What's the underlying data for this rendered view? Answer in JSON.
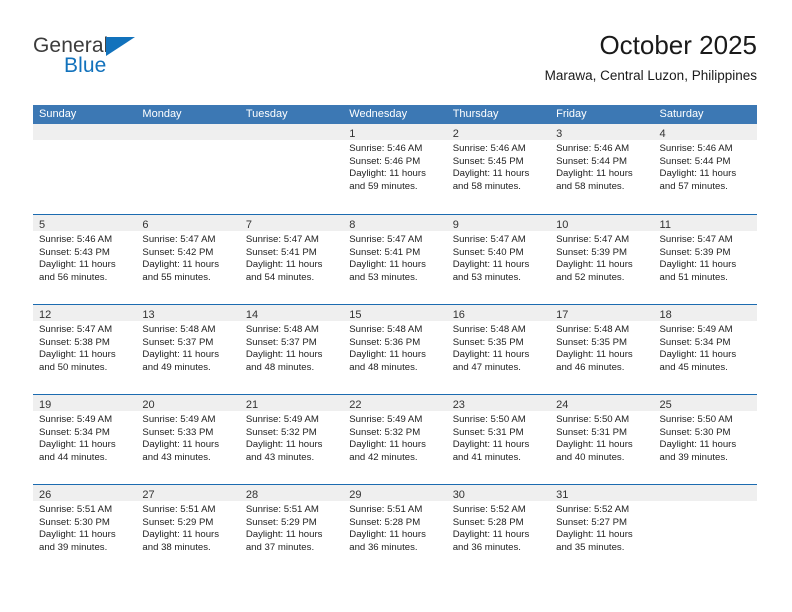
{
  "brand": {
    "name_part1": "General",
    "name_part2": "Blue"
  },
  "header": {
    "title": "October 2025",
    "subtitle": "Marawa, Central Luzon, Philippines"
  },
  "colors": {
    "header_blue": "#3c78b4",
    "week_divider_blue": "#1c6bb0",
    "daynum_strip": "#efefef",
    "brand_blue": "#1272bc"
  },
  "calendar": {
    "weekday_headers": [
      "Sunday",
      "Monday",
      "Tuesday",
      "Wednesday",
      "Thursday",
      "Friday",
      "Saturday"
    ],
    "weeks": [
      [
        {
          "day": "",
          "empty": true
        },
        {
          "day": "",
          "empty": true
        },
        {
          "day": "",
          "empty": true
        },
        {
          "day": "1",
          "sunrise": "Sunrise: 5:46 AM",
          "sunset": "Sunset: 5:46 PM",
          "daylight": "Daylight: 11 hours and 59 minutes."
        },
        {
          "day": "2",
          "sunrise": "Sunrise: 5:46 AM",
          "sunset": "Sunset: 5:45 PM",
          "daylight": "Daylight: 11 hours and 58 minutes."
        },
        {
          "day": "3",
          "sunrise": "Sunrise: 5:46 AM",
          "sunset": "Sunset: 5:44 PM",
          "daylight": "Daylight: 11 hours and 58 minutes."
        },
        {
          "day": "4",
          "sunrise": "Sunrise: 5:46 AM",
          "sunset": "Sunset: 5:44 PM",
          "daylight": "Daylight: 11 hours and 57 minutes."
        }
      ],
      [
        {
          "day": "5",
          "sunrise": "Sunrise: 5:46 AM",
          "sunset": "Sunset: 5:43 PM",
          "daylight": "Daylight: 11 hours and 56 minutes."
        },
        {
          "day": "6",
          "sunrise": "Sunrise: 5:47 AM",
          "sunset": "Sunset: 5:42 PM",
          "daylight": "Daylight: 11 hours and 55 minutes."
        },
        {
          "day": "7",
          "sunrise": "Sunrise: 5:47 AM",
          "sunset": "Sunset: 5:41 PM",
          "daylight": "Daylight: 11 hours and 54 minutes."
        },
        {
          "day": "8",
          "sunrise": "Sunrise: 5:47 AM",
          "sunset": "Sunset: 5:41 PM",
          "daylight": "Daylight: 11 hours and 53 minutes."
        },
        {
          "day": "9",
          "sunrise": "Sunrise: 5:47 AM",
          "sunset": "Sunset: 5:40 PM",
          "daylight": "Daylight: 11 hours and 53 minutes."
        },
        {
          "day": "10",
          "sunrise": "Sunrise: 5:47 AM",
          "sunset": "Sunset: 5:39 PM",
          "daylight": "Daylight: 11 hours and 52 minutes."
        },
        {
          "day": "11",
          "sunrise": "Sunrise: 5:47 AM",
          "sunset": "Sunset: 5:39 PM",
          "daylight": "Daylight: 11 hours and 51 minutes."
        }
      ],
      [
        {
          "day": "12",
          "sunrise": "Sunrise: 5:47 AM",
          "sunset": "Sunset: 5:38 PM",
          "daylight": "Daylight: 11 hours and 50 minutes."
        },
        {
          "day": "13",
          "sunrise": "Sunrise: 5:48 AM",
          "sunset": "Sunset: 5:37 PM",
          "daylight": "Daylight: 11 hours and 49 minutes."
        },
        {
          "day": "14",
          "sunrise": "Sunrise: 5:48 AM",
          "sunset": "Sunset: 5:37 PM",
          "daylight": "Daylight: 11 hours and 48 minutes."
        },
        {
          "day": "15",
          "sunrise": "Sunrise: 5:48 AM",
          "sunset": "Sunset: 5:36 PM",
          "daylight": "Daylight: 11 hours and 48 minutes."
        },
        {
          "day": "16",
          "sunrise": "Sunrise: 5:48 AM",
          "sunset": "Sunset: 5:35 PM",
          "daylight": "Daylight: 11 hours and 47 minutes."
        },
        {
          "day": "17",
          "sunrise": "Sunrise: 5:48 AM",
          "sunset": "Sunset: 5:35 PM",
          "daylight": "Daylight: 11 hours and 46 minutes."
        },
        {
          "day": "18",
          "sunrise": "Sunrise: 5:49 AM",
          "sunset": "Sunset: 5:34 PM",
          "daylight": "Daylight: 11 hours and 45 minutes."
        }
      ],
      [
        {
          "day": "19",
          "sunrise": "Sunrise: 5:49 AM",
          "sunset": "Sunset: 5:34 PM",
          "daylight": "Daylight: 11 hours and 44 minutes."
        },
        {
          "day": "20",
          "sunrise": "Sunrise: 5:49 AM",
          "sunset": "Sunset: 5:33 PM",
          "daylight": "Daylight: 11 hours and 43 minutes."
        },
        {
          "day": "21",
          "sunrise": "Sunrise: 5:49 AM",
          "sunset": "Sunset: 5:32 PM",
          "daylight": "Daylight: 11 hours and 43 minutes."
        },
        {
          "day": "22",
          "sunrise": "Sunrise: 5:49 AM",
          "sunset": "Sunset: 5:32 PM",
          "daylight": "Daylight: 11 hours and 42 minutes."
        },
        {
          "day": "23",
          "sunrise": "Sunrise: 5:50 AM",
          "sunset": "Sunset: 5:31 PM",
          "daylight": "Daylight: 11 hours and 41 minutes."
        },
        {
          "day": "24",
          "sunrise": "Sunrise: 5:50 AM",
          "sunset": "Sunset: 5:31 PM",
          "daylight": "Daylight: 11 hours and 40 minutes."
        },
        {
          "day": "25",
          "sunrise": "Sunrise: 5:50 AM",
          "sunset": "Sunset: 5:30 PM",
          "daylight": "Daylight: 11 hours and 39 minutes."
        }
      ],
      [
        {
          "day": "26",
          "sunrise": "Sunrise: 5:51 AM",
          "sunset": "Sunset: 5:30 PM",
          "daylight": "Daylight: 11 hours and 39 minutes."
        },
        {
          "day": "27",
          "sunrise": "Sunrise: 5:51 AM",
          "sunset": "Sunset: 5:29 PM",
          "daylight": "Daylight: 11 hours and 38 minutes."
        },
        {
          "day": "28",
          "sunrise": "Sunrise: 5:51 AM",
          "sunset": "Sunset: 5:29 PM",
          "daylight": "Daylight: 11 hours and 37 minutes."
        },
        {
          "day": "29",
          "sunrise": "Sunrise: 5:51 AM",
          "sunset": "Sunset: 5:28 PM",
          "daylight": "Daylight: 11 hours and 36 minutes."
        },
        {
          "day": "30",
          "sunrise": "Sunrise: 5:52 AM",
          "sunset": "Sunset: 5:28 PM",
          "daylight": "Daylight: 11 hours and 36 minutes."
        },
        {
          "day": "31",
          "sunrise": "Sunrise: 5:52 AM",
          "sunset": "Sunset: 5:27 PM",
          "daylight": "Daylight: 11 hours and 35 minutes."
        },
        {
          "day": "",
          "empty": true
        }
      ]
    ]
  }
}
